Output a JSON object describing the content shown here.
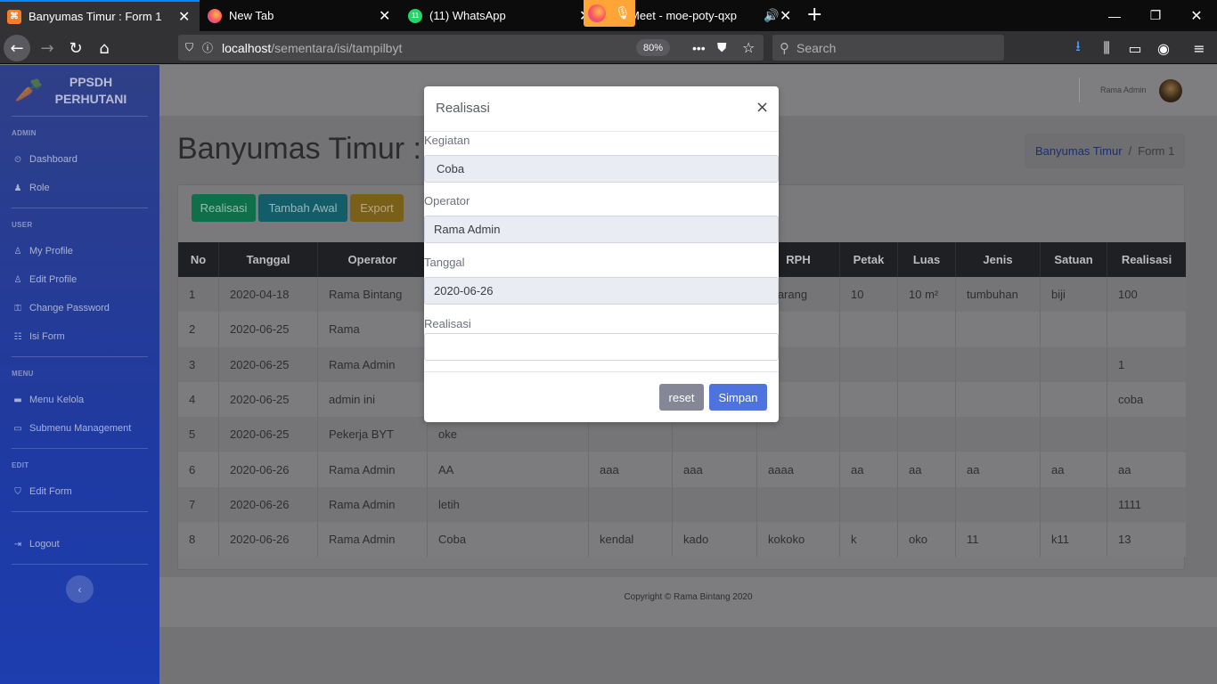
{
  "browser": {
    "tabs": [
      {
        "label": "Banyumas Timur : Form 1",
        "active": true
      },
      {
        "label": "New Tab",
        "active": false
      },
      {
        "label": "(11) WhatsApp",
        "active": false
      },
      {
        "label": "Meet - moe-poty-qxp",
        "active": false
      }
    ],
    "whatsapp_badge": "11",
    "url_host": "localhost",
    "url_path": "/sementara/isi/tampilbyt",
    "zoom": "80%",
    "search_placeholder": "Search",
    "accent": "#0a84ff"
  },
  "sidebar": {
    "brand_line1": "PPSDH",
    "brand_line2": "PERHUTANI",
    "sections": [
      {
        "heading": "ADMIN",
        "items": [
          "Dashboard",
          "Role"
        ]
      },
      {
        "heading": "USER",
        "items": [
          "My Profile",
          "Edit Profile",
          "Change Password",
          "Isi Form"
        ]
      },
      {
        "heading": "MENU",
        "items": [
          "Menu Kelola",
          "Submenu Management"
        ]
      },
      {
        "heading": "EDIT",
        "items": [
          "Edit Form"
        ]
      }
    ],
    "logout": "Logout",
    "toggle": "‹"
  },
  "topbar": {
    "user_name": "Rama Admin"
  },
  "page": {
    "title": "Banyumas Timur : F",
    "breadcrumb_link": "Banyumas Timur",
    "breadcrumb_sep": "/",
    "breadcrumb_current": "Form 1"
  },
  "actions": {
    "realisasi": "Realisasi",
    "tambah_awal": "Tambah Awal",
    "export": "Export"
  },
  "table": {
    "headers": [
      "No",
      "Tanggal",
      "Operator",
      "",
      "",
      "",
      "RPH",
      "Petak",
      "Luas",
      "Jenis",
      "Satuan",
      "Realisasi"
    ],
    "rows": [
      [
        "1",
        "2020-04-18",
        "Rama Bintang",
        "",
        "",
        "",
        "marang",
        "10",
        "10 m²",
        "tumbuhan",
        "biji",
        "100"
      ],
      [
        "2",
        "2020-06-25",
        "Rama",
        "",
        "",
        "",
        "",
        "",
        "",
        "",
        "",
        ""
      ],
      [
        "3",
        "2020-06-25",
        "Rama Admin",
        "",
        "",
        "",
        "",
        "",
        "",
        "",
        "",
        "1"
      ],
      [
        "4",
        "2020-06-25",
        "admin ini",
        "",
        "",
        "",
        "",
        "",
        "",
        "",
        "",
        "coba"
      ],
      [
        "5",
        "2020-06-25",
        "Pekerja BYT",
        "oke",
        "",
        "",
        "",
        "",
        "",
        "",
        "",
        ""
      ],
      [
        "6",
        "2020-06-26",
        "Rama Admin",
        "AA",
        "aaa",
        "aaa",
        "aaaa",
        "aa",
        "aa",
        "aa",
        "aa",
        "aa"
      ],
      [
        "7",
        "2020-06-26",
        "Rama Admin",
        "letih",
        "",
        "",
        "",
        "",
        "",
        "",
        "",
        "1111"
      ],
      [
        "8",
        "2020-06-26",
        "Rama Admin",
        "Coba",
        "kendal",
        "kado",
        "kokoko",
        "k",
        "oko",
        "11",
        "k11",
        "13"
      ]
    ]
  },
  "footer": {
    "copyright": "Copyright © Rama Bintang 2020"
  },
  "modal": {
    "title": "Realisasi",
    "close": "×",
    "kegiatan_label": "Kegiatan",
    "kegiatan_value": "Coba",
    "operator_label": "Operator",
    "operator_value": "Rama Admin",
    "tanggal_label": "Tanggal",
    "tanggal_value": "2020-06-26",
    "realisasi_label": "Realisasi",
    "realisasi_value": "",
    "reset": "reset",
    "simpan": "Simpan"
  }
}
